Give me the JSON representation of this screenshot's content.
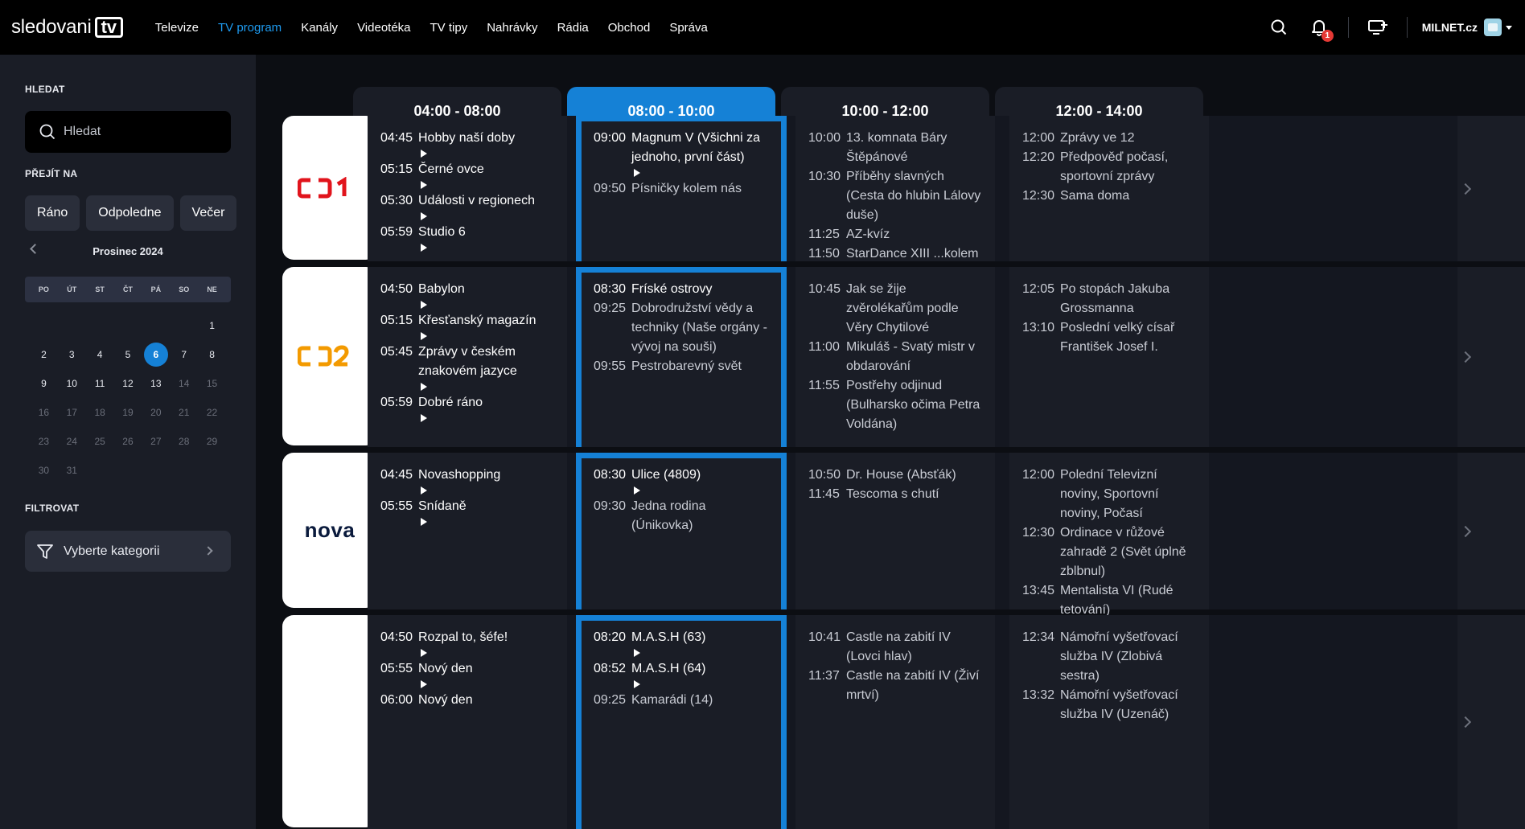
{
  "topbar": {
    "logo_text": "sledovani",
    "logo_box": "tv",
    "nav": [
      {
        "label": "Televize",
        "active": false
      },
      {
        "label": "TV program",
        "active": true
      },
      {
        "label": "Kanály",
        "active": false
      },
      {
        "label": "Videotéka",
        "active": false
      },
      {
        "label": "TV tipy",
        "active": false
      },
      {
        "label": "Nahrávky",
        "active": false
      },
      {
        "label": "Rádia",
        "active": false
      },
      {
        "label": "Obchod",
        "active": false
      },
      {
        "label": "Správa",
        "active": false
      }
    ],
    "notifications_count": "1",
    "account_name": "MILNET.cz"
  },
  "sidebar": {
    "search_label": "HLEDAT",
    "search_placeholder": "Hledat",
    "goto_label": "PŘEJÍT NA",
    "quick": [
      "Ráno",
      "Odpoledne",
      "Večer"
    ],
    "calendar": {
      "month": "Prosinec 2024",
      "weekdays": [
        "PO",
        "ÚT",
        "ST",
        "ČT",
        "PÁ",
        "SO",
        "NE"
      ],
      "offset": 6,
      "days": 31,
      "today": 6,
      "last_active": 13
    },
    "filter_label": "FILTROVAT",
    "filter_button": "Vyberte kategorii"
  },
  "slots": [
    "04:00 - 08:00",
    "08:00 - 10:00",
    "10:00 - 12:00",
    "12:00 - 14:00"
  ],
  "current_slot": 1,
  "channels": [
    {
      "name": "ČT1",
      "logo_color": "#e1141c",
      "slots": [
        [
          {
            "time": "04:45",
            "title": "Hobby naší doby",
            "play": true
          },
          {
            "time": "05:15",
            "title": "Černé ovce",
            "play": true
          },
          {
            "time": "05:30",
            "title": "Události v regionech",
            "play": true
          },
          {
            "time": "05:59",
            "title": "Studio 6",
            "play": true
          }
        ],
        [
          {
            "time": "09:00",
            "title": "Magnum V (Všichni za jednoho, první část)",
            "play": true
          },
          {
            "time": "09:50",
            "title": "Písničky kolem nás",
            "play": false
          }
        ],
        [
          {
            "time": "10:00",
            "title": "13. komnata Báry Štěpánové",
            "play": false
          },
          {
            "time": "10:30",
            "title": "Příběhy slavných (Cesta do hlubin Lálovy duše)",
            "play": false
          },
          {
            "time": "11:25",
            "title": "AZ-kvíz",
            "play": false
          },
          {
            "time": "11:50",
            "title": "StarDance XIII ...kolem dokola",
            "play": false
          }
        ],
        [
          {
            "time": "12:00",
            "title": "Zprávy ve 12",
            "play": false
          },
          {
            "time": "12:20",
            "title": "Předpověď počasí, sportovní zprávy",
            "play": false
          },
          {
            "time": "12:30",
            "title": "Sama doma",
            "play": false
          }
        ]
      ]
    },
    {
      "name": "ČT2",
      "logo_color": "#f39a00",
      "slots": [
        [
          {
            "time": "04:50",
            "title": "Babylon",
            "play": true
          },
          {
            "time": "05:15",
            "title": "Křesťanský magazín",
            "play": true
          },
          {
            "time": "05:45",
            "title": "Zprávy v českém znakovém jazyce",
            "play": true
          },
          {
            "time": "05:59",
            "title": "Dobré ráno",
            "play": true
          }
        ],
        [
          {
            "time": "08:30",
            "title": "Fríské ostrovy",
            "play": false,
            "past": true
          },
          {
            "time": "09:25",
            "title": "Dobrodružství vědy a techniky (Naše orgány - vývoj na souši)",
            "play": false
          },
          {
            "time": "09:55",
            "title": "Pestrobarevný svět",
            "play": false
          }
        ],
        [
          {
            "time": "10:45",
            "title": "Jak se žije zvěrolékařům podle Věry Chytilové",
            "play": false
          },
          {
            "time": "11:00",
            "title": "Mikuláš - Svatý mistr v obdarování",
            "play": false
          },
          {
            "time": "11:55",
            "title": "Postřehy odjinud (Bulharsko očima Petra Voldána)",
            "play": false
          }
        ],
        [
          {
            "time": "12:05",
            "title": "Po stopách Jakuba Grossmanna",
            "play": false
          },
          {
            "time": "13:10",
            "title": "Poslední velký císař František Josef I.",
            "play": false
          }
        ]
      ]
    },
    {
      "name": "nova",
      "logo_color": "#0a1a3c",
      "slots": [
        [
          {
            "time": "04:45",
            "title": "Novashopping",
            "play": true
          },
          {
            "time": "05:55",
            "title": "Snídaně",
            "play": true
          }
        ],
        [
          {
            "time": "08:30",
            "title": "Ulice (4809)",
            "play": true
          },
          {
            "time": "09:30",
            "title": "Jedna rodina (Únikovka)",
            "play": false
          }
        ],
        [
          {
            "time": "10:50",
            "title": "Dr. House (Absťák)",
            "play": false
          },
          {
            "time": "11:45",
            "title": "Tescoma s chutí",
            "play": false
          }
        ],
        [
          {
            "time": "12:00",
            "title": "Polední Televizní noviny, Sportovní noviny, Počasí",
            "play": false
          },
          {
            "time": "12:30",
            "title": "Ordinace v růžové zahradě 2 (Svět úplně zblbnul)",
            "play": false
          },
          {
            "time": "13:45",
            "title": "Mentalista VI (Rudé tetování)",
            "play": false
          }
        ]
      ]
    },
    {
      "name": "",
      "logo_color": "#ffffff",
      "slots": [
        [
          {
            "time": "04:50",
            "title": "Rozpal to, šéfe!",
            "play": true
          },
          {
            "time": "05:55",
            "title": "Nový den",
            "play": true
          },
          {
            "time": "06:00",
            "title": "Nový den",
            "play": false
          }
        ],
        [
          {
            "time": "08:20",
            "title": "M.A.S.H (63)",
            "play": true
          },
          {
            "time": "08:52",
            "title": "M.A.S.H (64)",
            "play": true
          },
          {
            "time": "09:25",
            "title": "Kamarádi (14)",
            "play": false
          }
        ],
        [
          {
            "time": "10:41",
            "title": "Castle na zabití IV (Lovci hlav)",
            "play": false
          },
          {
            "time": "11:37",
            "title": "Castle na zabití IV (Živí mrtví)",
            "play": false
          }
        ],
        [
          {
            "time": "12:34",
            "title": "Námořní vyšetřovací služba IV (Zlobivá sestra)",
            "play": false
          },
          {
            "time": "13:32",
            "title": "Námořní vyšetřovací služba IV (Uzenáč)",
            "play": false
          }
        ]
      ]
    }
  ]
}
